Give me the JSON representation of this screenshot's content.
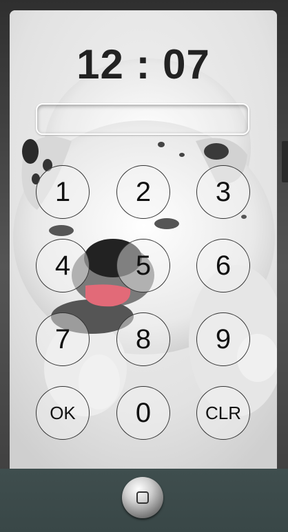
{
  "lockscreen": {
    "clock": "12 : 07",
    "pin_value": "",
    "keys": [
      "1",
      "2",
      "3",
      "4",
      "5",
      "6",
      "7",
      "8",
      "9",
      "OK",
      "0",
      "CLR"
    ]
  },
  "wallpaper": {
    "subject": "white-bulldog-photo"
  },
  "colors": {
    "bottom_bar": "#3d4b4b",
    "clock_text": "#222222",
    "key_border": "#333333"
  },
  "home": {
    "icon": "home-square-icon"
  }
}
